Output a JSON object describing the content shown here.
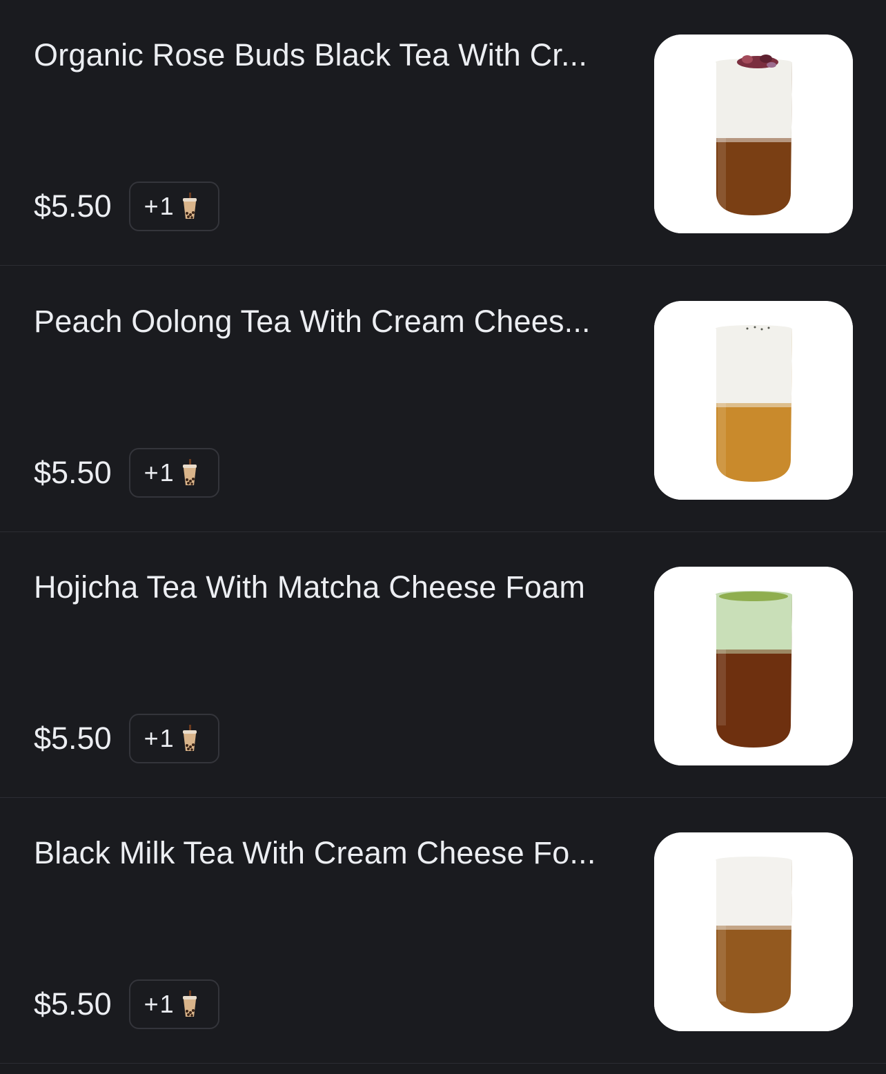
{
  "menu": {
    "items": [
      {
        "name": "Organic Rose Buds Black Tea With Cr...",
        "price": "$5.50",
        "addon": "+1",
        "addon_icon": "bubble-tea-icon",
        "image": "rose-black-tea-cream-cheese-drink",
        "colors": {
          "foam": "#f1f0eb",
          "tea": "#7a3f14",
          "topping": "#7b2f3f"
        }
      },
      {
        "name": "Peach Oolong Tea With Cream Chees...",
        "price": "$5.50",
        "addon": "+1",
        "addon_icon": "bubble-tea-icon",
        "image": "peach-oolong-cream-cheese-drink",
        "colors": {
          "foam": "#f2f1ec",
          "tea": "#c98a2c",
          "topping": "#55574f"
        }
      },
      {
        "name": "Hojicha Tea With Matcha Cheese Foam",
        "price": "$5.50",
        "addon": "+1",
        "addon_icon": "bubble-tea-icon",
        "image": "hojicha-matcha-cheese-foam-drink",
        "colors": {
          "foam": "#c9dfb8",
          "tea": "#6e300f",
          "topping": "#8fae4f"
        }
      },
      {
        "name": "Black Milk Tea With Cream Cheese Fo...",
        "price": "$5.50",
        "addon": "+1",
        "addon_icon": "bubble-tea-icon",
        "image": "black-milk-tea-cream-cheese-drink",
        "colors": {
          "foam": "#f3f2ee",
          "tea": "#93591f",
          "topping": "#f3f2ee"
        }
      }
    ]
  }
}
